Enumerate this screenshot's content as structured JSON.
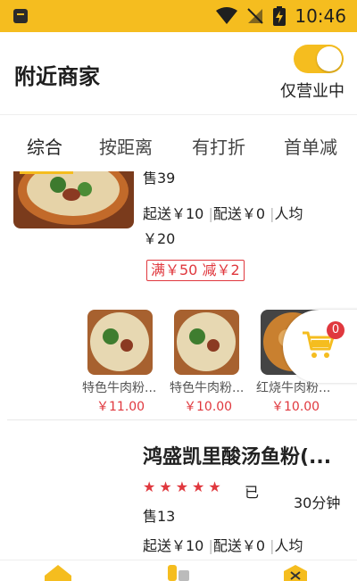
{
  "status_bar": {
    "time": "10:46"
  },
  "header": {
    "title": "附近商家",
    "open_only_label": "仅营业中",
    "open_only_on": true
  },
  "tabs": [
    "综合",
    "按距离",
    "有打折",
    "首单减"
  ],
  "shop1": {
    "sold_fragment": "售39",
    "min_order": "起送￥10",
    "delivery_fee": "配送￥0",
    "per_capita_label": "人均",
    "per_capita_value": "￥20",
    "promo": "满￥50 减￥2",
    "dishes": [
      {
        "name": "特色牛肉粉...",
        "price": "￥11.00"
      },
      {
        "name": "特色牛肉粉...",
        "price": "￥10.00"
      },
      {
        "name": "红烧牛肉粉...",
        "price": "￥10.00"
      }
    ]
  },
  "shop2": {
    "name": "鸿盛凯里酸汤鱼粉(...",
    "rating": 5,
    "sold_prefix": "已",
    "sold_suffix": "售13",
    "delivery_time": "30分钟",
    "min_order": "起送￥10",
    "delivery_fee": "配送￥0",
    "per_capita_label": "人均"
  },
  "cart": {
    "count": "0",
    "icon": "shopping-cart-icon"
  },
  "colors": {
    "brand_yellow": "#f5bd1f",
    "promo_red": "#e0383e"
  }
}
